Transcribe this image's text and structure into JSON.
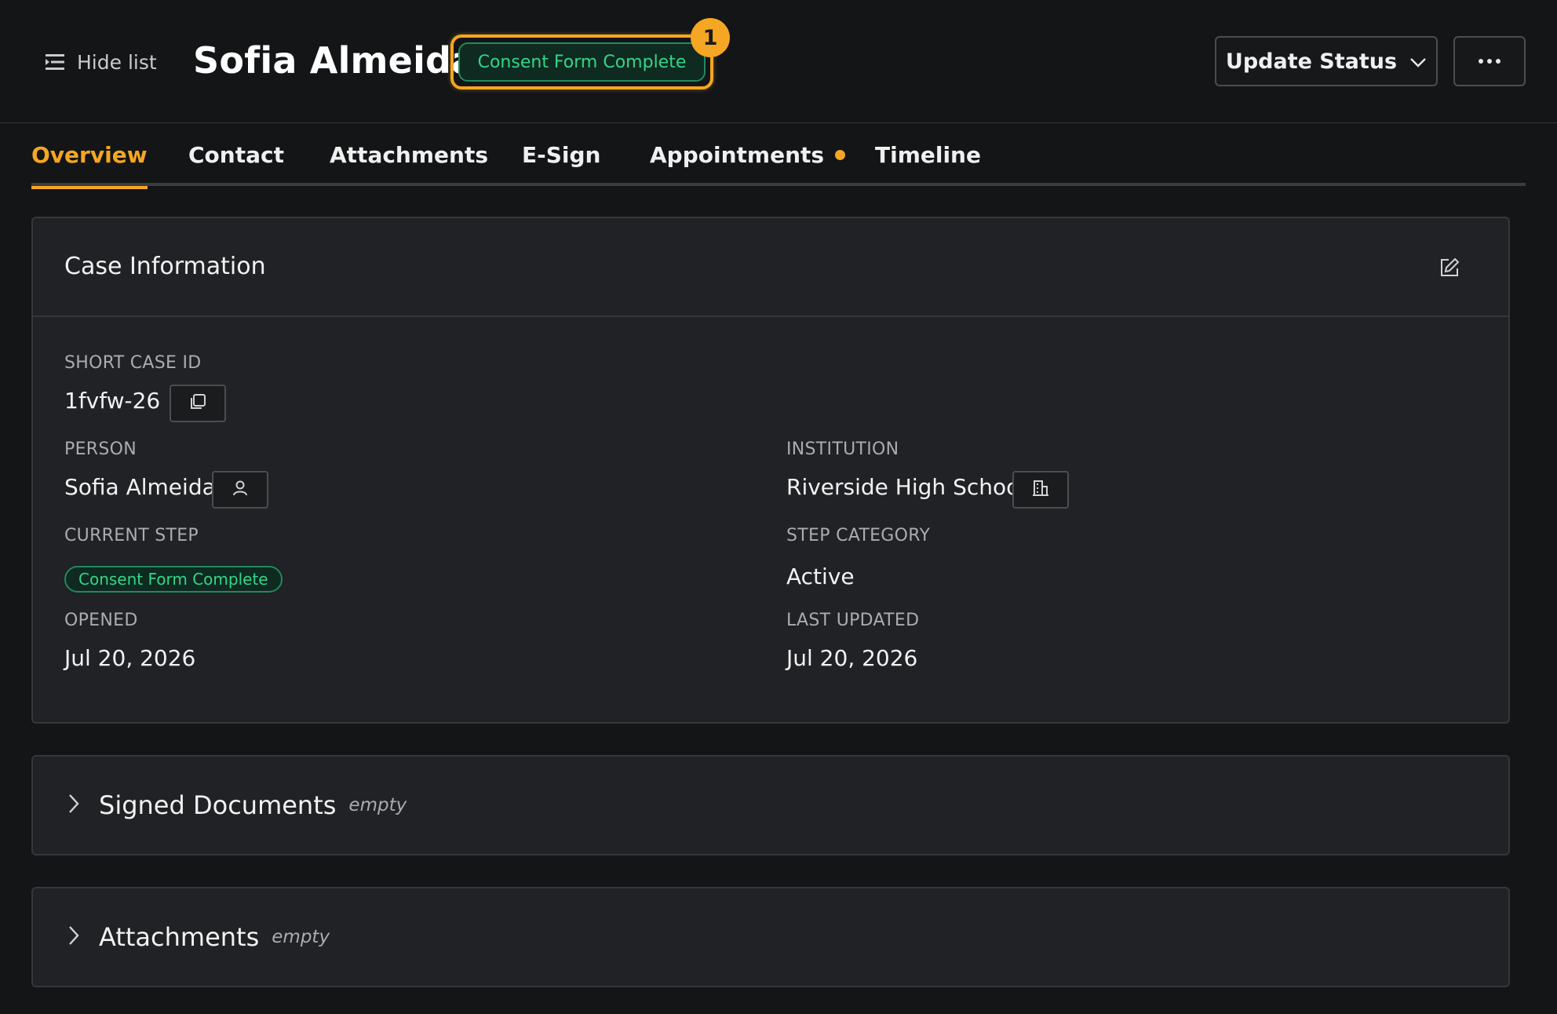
{
  "header": {
    "hide_list_label": "Hide list",
    "title": "Sofia Almeida",
    "status_badge": "Consent Form Complete",
    "notification_count": "1",
    "update_status_label": "Update Status"
  },
  "tabs": [
    {
      "label": "Overview",
      "active": true
    },
    {
      "label": "Contact"
    },
    {
      "label": "Attachments"
    },
    {
      "label": "E-Sign"
    },
    {
      "label": "Appointments",
      "has_dot": true
    },
    {
      "label": "Timeline"
    }
  ],
  "case_info": {
    "title": "Case Information",
    "short_case_id_label": "SHORT CASE ID",
    "short_case_id": "1fvfw-26",
    "person_label": "PERSON",
    "person": "Sofia Almeida",
    "institution_label": "INSTITUTION",
    "institution": "Riverside High School",
    "current_step_label": "CURRENT STEP",
    "current_step": "Consent Form Complete",
    "step_category_label": "STEP CATEGORY",
    "step_category": "Active",
    "opened_label": "OPENED",
    "opened": "Jul 20, 2026",
    "last_updated_label": "LAST UPDATED",
    "last_updated": "Jul 20, 2026"
  },
  "sections": {
    "signed_documents": {
      "title": "Signed Documents",
      "state": "empty"
    },
    "attachments": {
      "title": "Attachments",
      "state": "empty"
    }
  },
  "colors": {
    "accent": "#f5a623",
    "status_green": "#34d58a",
    "background": "#141516",
    "card": "#202225"
  }
}
